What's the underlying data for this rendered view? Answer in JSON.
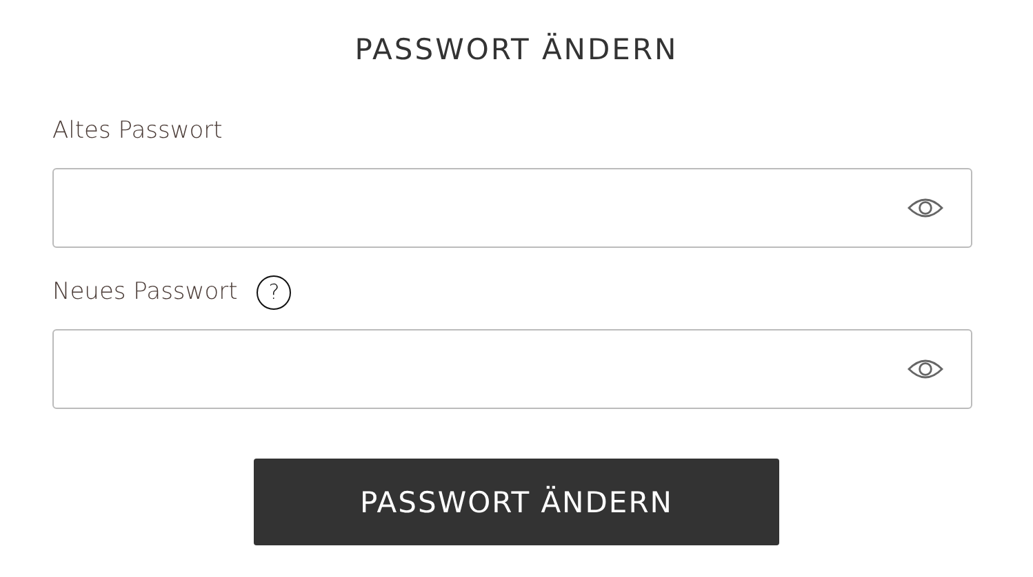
{
  "title": "PASSWORT ÄNDERN",
  "fields": [
    {
      "label": "Altes Passwort"
    },
    {
      "label": "Neues Passwort",
      "help": "?"
    }
  ],
  "submit_button": "PASSWORT ÄNDERN"
}
